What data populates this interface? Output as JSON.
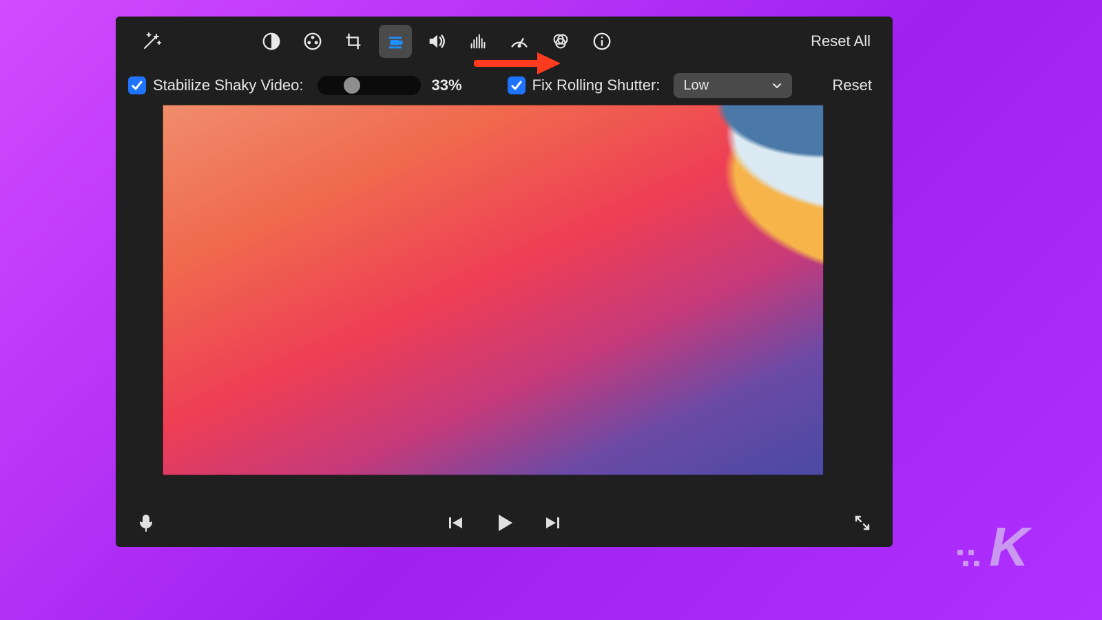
{
  "toolbar": {
    "reset_all": "Reset All"
  },
  "options": {
    "stabilize_label": "Stabilize Shaky Video:",
    "stabilize_pct": "33%",
    "fix_label": "Fix Rolling Shutter:",
    "fix_value": "Low",
    "reset": "Reset"
  },
  "watermark": {
    "letter": "K"
  }
}
